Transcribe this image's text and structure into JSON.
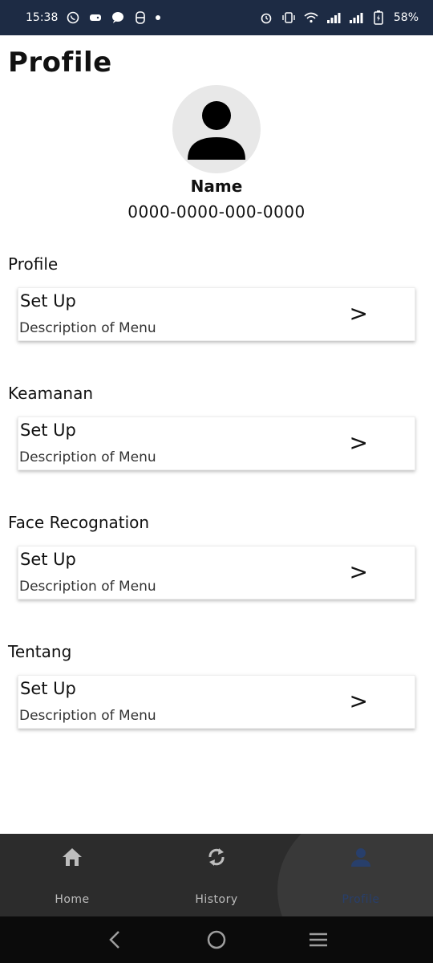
{
  "status_bar": {
    "time": "15:38",
    "battery": "58%"
  },
  "page": {
    "title": "Profile"
  },
  "user": {
    "name": "Name",
    "phone": "0000-0000-000-0000"
  },
  "sections": [
    {
      "title": "Profile",
      "card_title": "Set Up",
      "card_desc": "Description of Menu",
      "chevron": ">"
    },
    {
      "title": "Keamanan",
      "card_title": "Set Up",
      "card_desc": "Description of Menu",
      "chevron": ">"
    },
    {
      "title": "Face Recognation",
      "card_title": "Set Up",
      "card_desc": "Description of Menu",
      "chevron": ">"
    },
    {
      "title": "Tentang",
      "card_title": "Set Up",
      "card_desc": "Description of Menu",
      "chevron": ">"
    }
  ],
  "bottom_nav": {
    "items": [
      {
        "label": "Home",
        "icon": "home-icon"
      },
      {
        "label": "History",
        "icon": "refresh-icon"
      },
      {
        "label": "Profile",
        "icon": "person-icon",
        "active": true
      }
    ],
    "active_color": "#283f6b"
  }
}
